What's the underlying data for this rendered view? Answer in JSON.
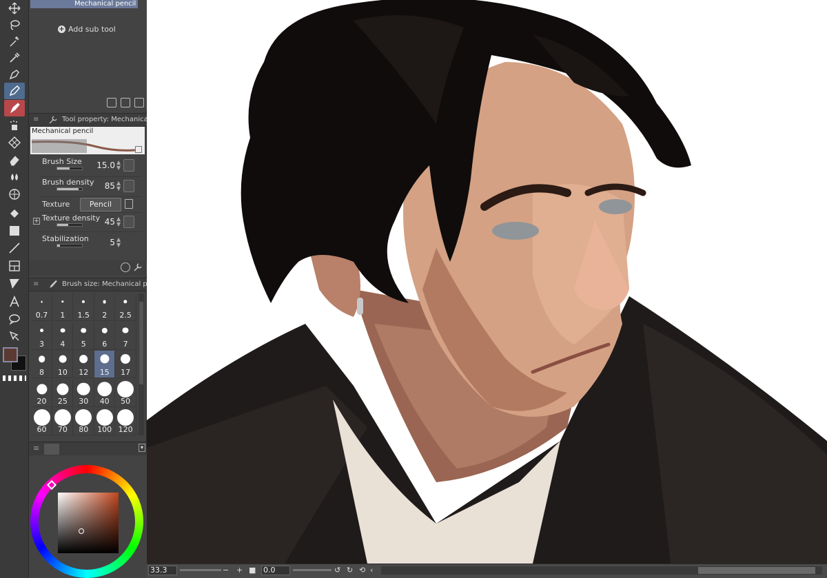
{
  "subtool": {
    "selected_item": "Mechanical pencil",
    "add_label": "Add sub tool"
  },
  "tool_property": {
    "header": "Tool property: Mechanical p",
    "preset_name": "Mechanical pencil",
    "rows": {
      "brush_size": {
        "label": "Brush Size",
        "value": "15.0",
        "level": 0.5
      },
      "brush_density": {
        "label": "Brush density",
        "value": "85",
        "level": 0.85
      },
      "texture": {
        "label": "Texture",
        "value": "Pencil"
      },
      "texture_density": {
        "label": "Texture density",
        "value": "45",
        "level": 0.45
      },
      "stabilization": {
        "label": "Stabilization",
        "value": "5",
        "level": 0.1
      }
    }
  },
  "brush_size_panel": {
    "header": "Brush size: Mechanical pen",
    "sizes": [
      "0.7",
      "1",
      "1.5",
      "2",
      "2.5",
      "3",
      "4",
      "5",
      "6",
      "7",
      "8",
      "10",
      "12",
      "15",
      "17",
      "20",
      "25",
      "30",
      "40",
      "50",
      "60",
      "70",
      "80",
      "100",
      "120"
    ],
    "selected": "15"
  },
  "color": {
    "main": "#5b3a33",
    "sub": "#111111",
    "hue": "#c0461e"
  },
  "statusbar": {
    "zoom": "33.3",
    "angle": "0.0"
  }
}
